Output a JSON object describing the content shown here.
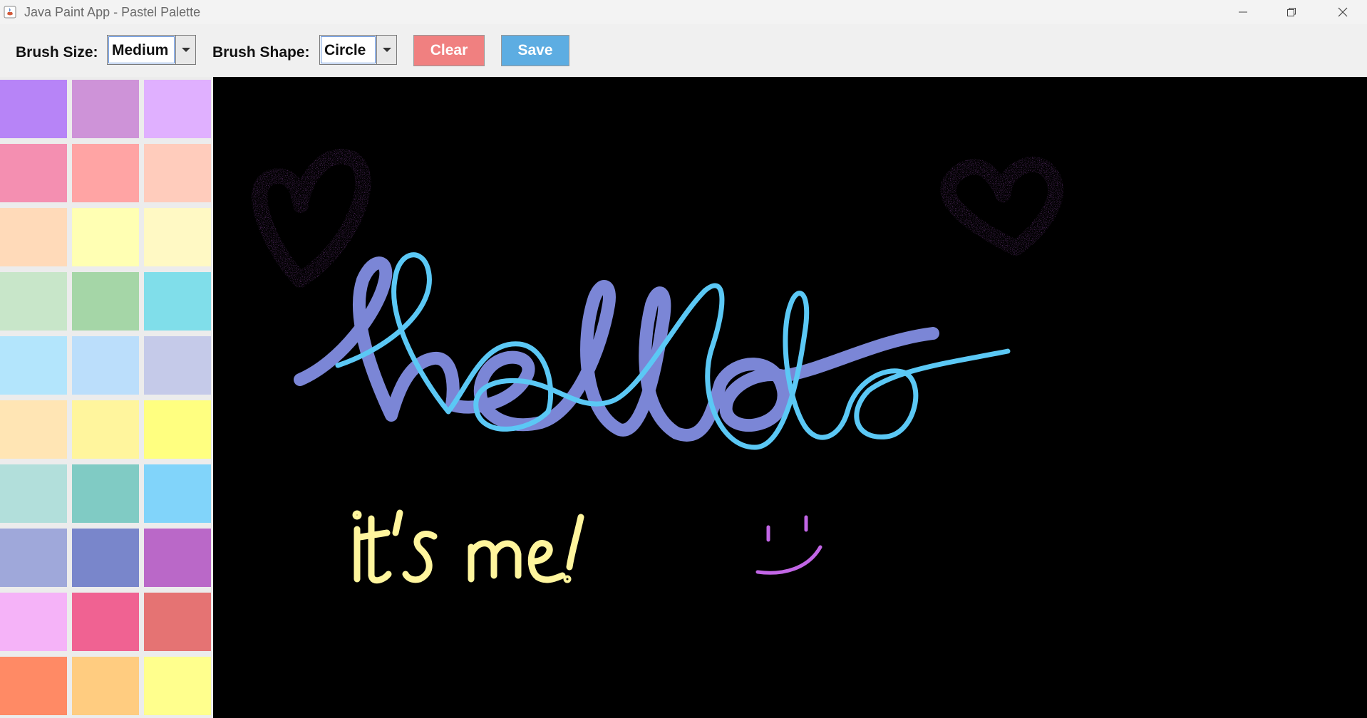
{
  "window": {
    "title": "Java Paint App - Pastel Palette",
    "app_icon": "java-cup-icon",
    "controls": [
      "minimize-icon",
      "restore-icon",
      "close-icon"
    ]
  },
  "toolbar": {
    "brush_size_label": "Brush Size:",
    "brush_size_value": "Medium",
    "brush_shape_label": "Brush Shape:",
    "brush_shape_value": "Circle",
    "clear_label": "Clear",
    "save_label": "Save",
    "clear_color": "#f08080",
    "save_color": "#5dade2"
  },
  "palette": {
    "colors": [
      [
        "#b784f7",
        "#ce93d8",
        "#e0b0ff"
      ],
      [
        "#f48fb1",
        "#ffa4a4",
        "#ffccbc"
      ],
      [
        "#ffdab9",
        "#ffffb3",
        "#fff9c4"
      ],
      [
        "#c8e6c9",
        "#a5d6a7",
        "#80deea"
      ],
      [
        "#b3e5fc",
        "#bbdefb",
        "#c5cae9"
      ],
      [
        "#ffe5b4",
        "#fff59d",
        "#ffff80"
      ],
      [
        "#b2dfdb",
        "#80cbc4",
        "#81d4fa"
      ],
      [
        "#9fa8da",
        "#7986cb",
        "#ba68c8"
      ],
      [
        "#f5b3f8",
        "#f06292",
        "#e57373"
      ],
      [
        "#ff8a65",
        "#ffcc80",
        "#ffff8d"
      ]
    ]
  },
  "canvas": {
    "background": "#000000",
    "drawing_colors": {
      "hearts": "#c266e6",
      "hello_dark": "#7b86d6",
      "hello_light": "#5bc8f5",
      "its_me": "#fff59d",
      "smiley": "#c266e6"
    }
  }
}
